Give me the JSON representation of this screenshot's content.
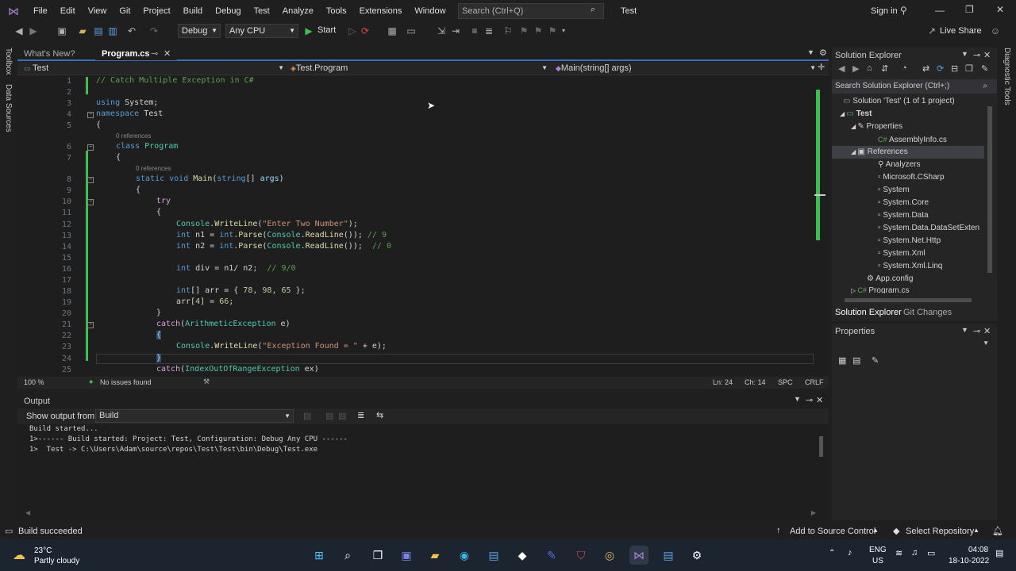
{
  "menubar": {
    "items": [
      "File",
      "Edit",
      "View",
      "Git",
      "Project",
      "Build",
      "Debug",
      "Test",
      "Analyze",
      "Tools",
      "Extensions",
      "Window",
      "Help"
    ],
    "search_placeholder": "Search (Ctrl+Q)",
    "solution_name": "Test",
    "sign_in": "Sign in"
  },
  "toolbar": {
    "config": "Debug",
    "platform": "Any CPU",
    "start_label": "Start",
    "live_share": "Live Share"
  },
  "left_strip": {
    "toolbox": "Toolbox",
    "data_sources": "Data Sources"
  },
  "right_strip": {
    "diagnostic_tools": "Diagnostic Tools"
  },
  "doc_tabs": [
    {
      "label": "What's New?",
      "active": false
    },
    {
      "label": "Program.cs",
      "active": true
    }
  ],
  "navbar": {
    "project": "Test",
    "type": "Test.Program",
    "member": "Main(string[] args)"
  },
  "editor": {
    "refs_label": "0 references",
    "line_numbers": [
      "1",
      "2",
      "3",
      "4",
      "5",
      "6",
      "7",
      "8",
      "9",
      "10",
      "11",
      "12",
      "13",
      "14",
      "15",
      "16",
      "17",
      "18",
      "19",
      "20",
      "21",
      "22",
      "23",
      "24",
      "25"
    ],
    "code": {
      "l1": "// Catch Multiple Exception in C#",
      "l3a": "using",
      "l3b": " System;",
      "l4a": "namespace",
      "l4b": " Test",
      "l5": "{",
      "l6a": "class",
      "l6b": " Program",
      "l7": "{",
      "l8a": "static void",
      "l8b": " Main",
      "l8c": "(",
      "l8d": "string",
      "l8e": "[] ",
      "l8f": "args",
      "l8g": ")",
      "l9": "{",
      "l10": "try",
      "l11": "{",
      "l12a": "Console",
      "l12b": ".",
      "l12c": "WriteLine",
      "l12d": "(",
      "l12e": "\"Enter Two Number\"",
      "l12f": ");",
      "l13a": "int",
      "l13b": " n1 = ",
      "l13c": "int",
      "l13d": ".",
      "l13e": "Parse",
      "l13f": "(",
      "l13g": "Console",
      "l13h": ".",
      "l13i": "ReadLine",
      "l13j": "()); ",
      "l13k": "// 9",
      "l14a": "int",
      "l14b": " n2 = ",
      "l14c": "int",
      "l14d": ".",
      "l14e": "Parse",
      "l14f": "(",
      "l14g": "Console",
      "l14h": ".",
      "l14i": "ReadLine",
      "l14j": "());  ",
      "l14k": "// 0",
      "l16a": "int",
      "l16b": " div = n1/ n2;  ",
      "l16c": "// 9/0",
      "l18a": "int",
      "l18b": "[] arr = { ",
      "l18c": "78",
      "l18d": ", ",
      "l18e": "98",
      "l18f": ", ",
      "l18g": "65",
      "l18h": " };",
      "l19a": "arr[",
      "l19b": "4",
      "l19c": "] = ",
      "l19d": "66",
      "l19e": ";",
      "l20": "}",
      "l21a": "catch",
      "l21b": "(",
      "l21c": "ArithmeticException",
      "l21d": " e)",
      "l22": "{",
      "l23a": "Console",
      "l23b": ".",
      "l23c": "WriteLine",
      "l23d": "(",
      "l23e": "\"Exception Found = \"",
      "l23f": " + e);",
      "l24": "}",
      "l25a": "catch",
      "l25b": "(",
      "l25c": "IndexOutOfRangeException",
      "l25d": " ex)"
    }
  },
  "editor_status": {
    "zoom": "100 %",
    "issues": "No issues found",
    "line": "Ln: 24",
    "col": "Ch: 14",
    "whitespace": "SPC",
    "eol": "CRLF"
  },
  "output": {
    "title": "Output",
    "show_from_label": "Show output from:",
    "source": "Build",
    "lines": [
      "Build started...",
      "1>------ Build started: Project: Test, Configuration: Debug Any CPU ------",
      "1>  Test -> C:\\Users\\Adam\\source\\repos\\Test\\Test\\bin\\Debug\\Test.exe"
    ]
  },
  "solution_explorer": {
    "title": "Solution Explorer",
    "search_placeholder": "Search Solution Explorer (Ctrl+;)",
    "items": [
      "Solution 'Test' (1 of 1 project)",
      "Test",
      "Properties",
      "AssemblyInfo.cs",
      "References",
      "Analyzers",
      "Microsoft.CSharp",
      "System",
      "System.Core",
      "System.Data",
      "System.Data.DataSetExten",
      "System.Net.Http",
      "System.Xml",
      "System.Xml.Linq",
      "App.config",
      "Program.cs"
    ],
    "tabs": [
      "Solution Explorer",
      "Git Changes"
    ]
  },
  "properties": {
    "title": "Properties"
  },
  "statusbar": {
    "message": "Build succeeded",
    "source_control": "Add to Source Control",
    "repository": "Select Repository"
  },
  "taskbar": {
    "temperature": "23°C",
    "weather": "Partly cloudy",
    "lang1": "ENG",
    "lang2": "US",
    "time": "04:08",
    "date": "18-10-2022"
  }
}
